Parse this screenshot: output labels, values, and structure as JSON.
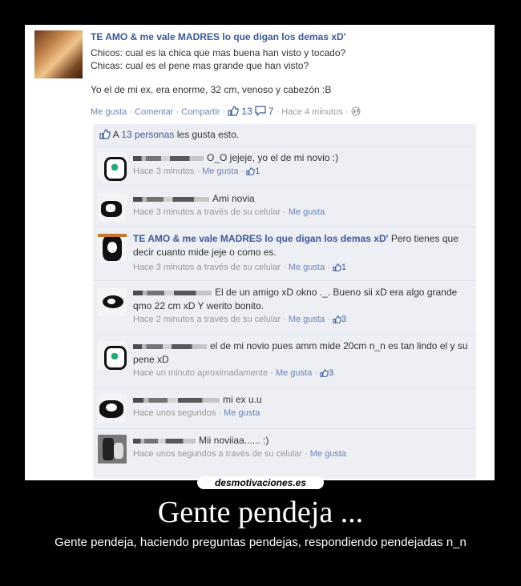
{
  "post": {
    "author": "TE AMO & me vale MADRES lo que digan los demas xD'",
    "lines": [
      "Chicos: cual es la chica que mas buena han visto y tocado?",
      "Chicas: cual es el pene mas grande que han visto?",
      "Yo el de mi ex, era enorme, 32 cm, venoso y cabezón :B"
    ],
    "actions": {
      "like": "Me gusta",
      "comment": "Comentar",
      "share": "Compartir",
      "like_count": "13",
      "comment_count": "7",
      "time": "Hace 4 minutos",
      "separator": "·"
    },
    "likes_summary": {
      "prefix": "A",
      "link": "13 personas",
      "suffix": "les gusta esto."
    }
  },
  "comments": [
    {
      "name": "",
      "text": "O_O jejeje, yo el de mi novio :)",
      "time": "Hace 3 minutos",
      "via": "",
      "like": "Me gusta",
      "count": "1"
    },
    {
      "name": "",
      "text": "Ami novia",
      "time": "Hace 3 minutos a través de su celular",
      "via": "",
      "like": "Me gusta",
      "count": ""
    },
    {
      "name": "TE AMO & me vale MADRES lo que digan los demas xD'",
      "text": "Pero tienes que decir cuanto mide jeje o como es.",
      "time": "Hace 3 minutos a través de su celular",
      "via": "",
      "like": "Me gusta",
      "count": "1"
    },
    {
      "name": "",
      "text": "El de un amigo xD okno ._. Bueno sii xD era algo grande qmo 22 cm xD Y werito bonito.",
      "time": "Hace 2 minutos a través de su celular",
      "via": "",
      "like": "Me gusta",
      "count": "3"
    },
    {
      "name": "",
      "text": "el de mi novio pues amm mide 20cm n_n es tan lindo el y su pene xD",
      "time": "Hace un minuto aproximadamente",
      "via": "",
      "like": "Me gusta",
      "count": "3"
    },
    {
      "name": "",
      "text": "mi ex u.u",
      "time": "Hace unos segundos",
      "via": "",
      "like": "Me gusta",
      "count": ""
    },
    {
      "name": "",
      "text": "Mii noviiaa...... :)",
      "time": "Hace unos segundos a través de su celular",
      "via": "",
      "like": "Me gusta",
      "count": ""
    }
  ],
  "caption": {
    "site": "desmotivaciones.es",
    "title": "Gente pendeja ...",
    "subtitle": "Gente pendeja, haciendo preguntas pendejas, respondiendo pendejadas n_n"
  },
  "colors": {
    "fb_blue": "#3b5998",
    "link": "#6d84b4",
    "comment_bg": "#edeff4",
    "background": "#000000"
  },
  "icons": [
    "thumbs-up-icon",
    "comment-bubble-icon",
    "globe-icon"
  ]
}
